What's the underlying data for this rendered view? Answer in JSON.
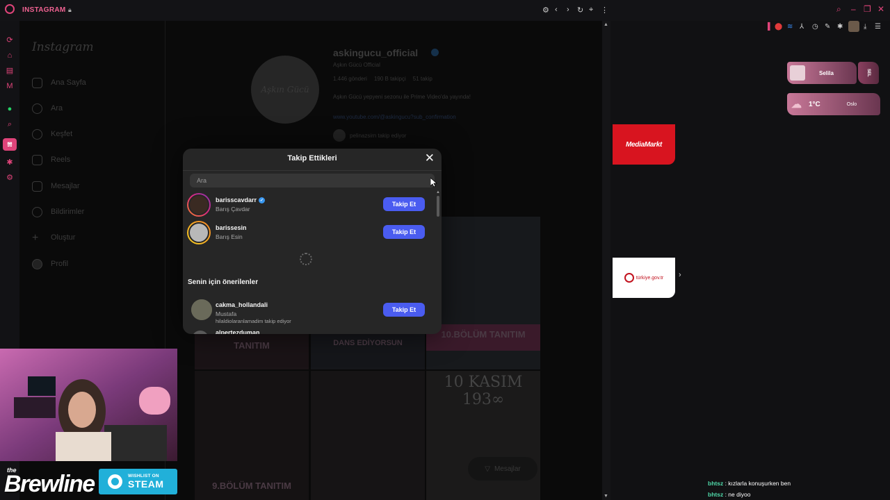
{
  "browser": {
    "site_title": "INSTAGRAM",
    "colors": {
      "accent": "#e0447a"
    }
  },
  "ig_nav": {
    "logo": "Instagram",
    "items": [
      "Ana Sayfa",
      "Ara",
      "Keşfet",
      "Reels",
      "Mesajlar",
      "Bildirimler",
      "Oluştur",
      "Profil"
    ]
  },
  "profile": {
    "username": "askingucu_official",
    "full_name": "Aşkın Gücü Official",
    "stats": [
      "1.446 gönderi",
      "190 B takipçi",
      "51 takip"
    ],
    "bio": "Aşkın Gücü yepyeni sezonu ile Prime Video'da yayında!",
    "link": "www.youtube.com/@askingucu?sub_confirmation",
    "followed_by": "pelinazsirn takip ediyor",
    "avatar_text": "Aşkın Gücü"
  },
  "posts": {
    "labels": [
      "TANITIM",
      "DANS EDİYORSUN",
      "10.BÖLÜM TANITIM",
      "9.BÖLÜM TANITIM",
      "10 KASIM 193∞"
    ],
    "messages_button": "Mesajlar"
  },
  "modal": {
    "title": "Takip Ettikleri",
    "search_placeholder": "Ara",
    "following": [
      {
        "username": "barisscavdarr",
        "full_name": "Barış Çavdar",
        "verified": true,
        "button": "Takip Et"
      },
      {
        "username": "barissesin",
        "full_name": "Barış Esin",
        "verified": false,
        "button": "Takip Et"
      }
    ],
    "suggested_heading": "Senin için önerilenler",
    "suggested": [
      {
        "username": "cakma_hollandali",
        "full_name": "Mustafa",
        "note": "hilaldiolaranlamadim takip ediyor",
        "button": "Takip Et"
      }
    ],
    "partial_username": "alpertezduman"
  },
  "right_pane": {
    "profile_widget_name": "Selila",
    "profile_widget_badge": "SEL",
    "weather": {
      "temp": "1°C",
      "city": "Oslo"
    },
    "tiles": [
      "MediaMarkt",
      "türkiye.gov.tr"
    ]
  },
  "chat": [
    {
      "user": "bhtsz",
      "message": "kızlarla konuşurken ben"
    },
    {
      "user": "bhtsz",
      "message": "ne diyoo"
    }
  ],
  "overlay": {
    "brand_the": "the",
    "brand_name": "Brewline",
    "steam_line1": "WISHLIST ON",
    "steam_line2": "STEAM"
  }
}
